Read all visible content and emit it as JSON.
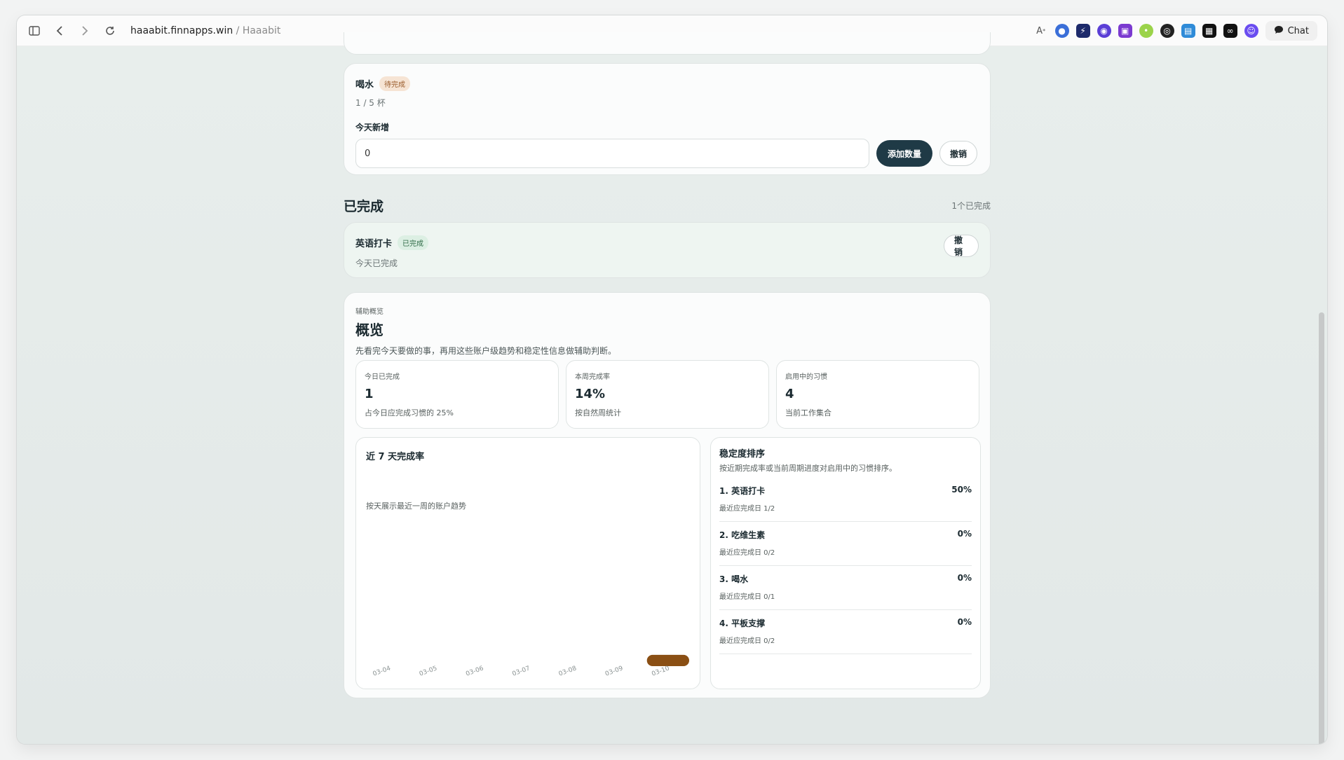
{
  "browser": {
    "url_host": "haaabit.finnapps.win",
    "url_sep": " / ",
    "url_title": "Haaabit",
    "chat_label": "Chat"
  },
  "pending_habit": {
    "name": "喝水",
    "badge": "待完成",
    "progress": "1 / 5 杯",
    "field_label": "今天新增",
    "input_value": "0",
    "add_button": "添加数量",
    "undo_button": "撤销"
  },
  "completed": {
    "section_title": "已完成",
    "count": "1个已完成",
    "item": {
      "name": "英语打卡",
      "badge": "已完成",
      "status": "今天已完成",
      "undo_button": "撤销"
    }
  },
  "overview": {
    "eyebrow": "辅助概览",
    "title": "概览",
    "description": "先看完今天要做的事，再用这些账户级趋势和稳定性信息做辅助判断。",
    "stats": [
      {
        "label": "今日已完成",
        "value": "1",
        "note": "占今日应完成习惯的 25%"
      },
      {
        "label": "本周完成率",
        "value": "14%",
        "note": "按自然周统计"
      },
      {
        "label": "启用中的习惯",
        "value": "4",
        "note": "当前工作集合"
      }
    ],
    "trend": {
      "title": "近 7 天完成率",
      "subtitle": "按天展示最近一周的账户趋势"
    },
    "ranking": {
      "title": "稳定度排序",
      "subtitle": "按近期完成率或当前周期进度对启用中的习惯排序。",
      "items": [
        {
          "name": "1. 英语打卡",
          "detail": "最近应完成日 1/2",
          "pct": "50%"
        },
        {
          "name": "2. 吃维生素",
          "detail": "最近应完成日 0/2",
          "pct": "0%"
        },
        {
          "name": "3. 喝水",
          "detail": "最近应完成日 0/1",
          "pct": "0%"
        },
        {
          "name": "4. 平板支撑",
          "detail": "最近应完成日 0/2",
          "pct": "0%"
        }
      ]
    }
  },
  "chart_data": {
    "type": "bar",
    "categories": [
      "03-04",
      "03-05",
      "03-06",
      "03-07",
      "03-08",
      "03-09",
      "03-10"
    ],
    "values": [
      0,
      0,
      0,
      0,
      0,
      0,
      0.07
    ],
    "title": "近 7 天完成率",
    "bar_color": "#8a4f14"
  },
  "colors": {
    "accent_dark": "#1f3a46",
    "pending_badge": "#f6e4d4",
    "done_badge": "#dcefe3",
    "done_card": "#eef5f1"
  }
}
